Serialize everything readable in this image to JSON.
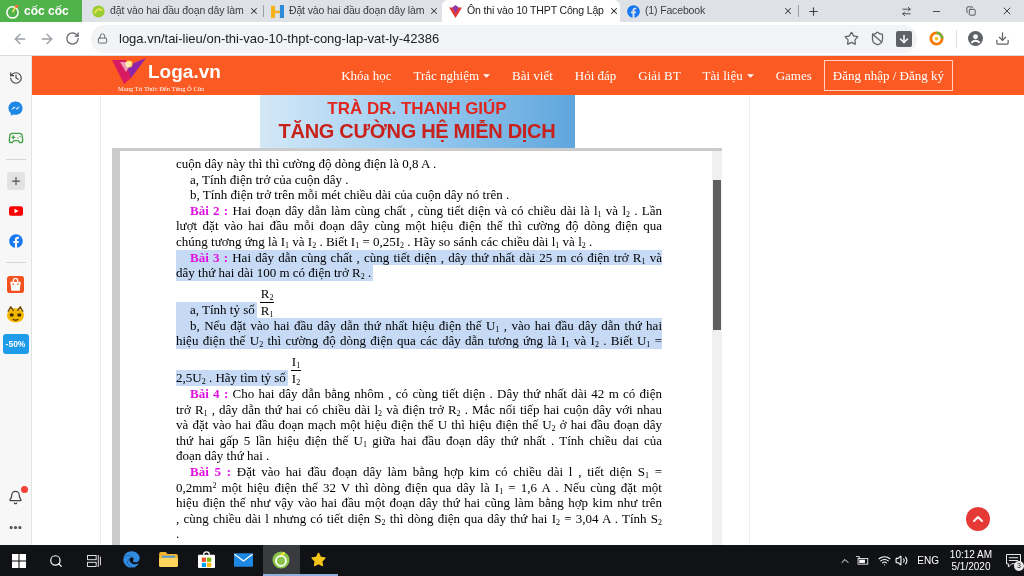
{
  "browser": {
    "brand": "cốc cốc",
    "tabs": [
      {
        "title": "đặt vào hai đầu đoạn dây làm",
        "kind": "swirl",
        "selected": false
      },
      {
        "title": "Đặt vào hai đầu đoạn dây làm",
        "kind": "bars",
        "selected": false
      },
      {
        "title": "Ôn thi vào 10 THPT Công Lập",
        "kind": "diamond",
        "selected": true
      },
      {
        "title": "(1) Facebook",
        "kind": "letter-f",
        "selected": false
      }
    ],
    "address": "loga.vn/tai-lieu/on-thi-vao-10-thpt-cong-lap-vat-ly-42386"
  },
  "sidebar": {
    "discount": "-50%",
    "notification_dot": true
  },
  "site": {
    "logo": "Loga.vn",
    "tagline": "Mang Tri Thức Đến Từng Ô Cửa",
    "nav": [
      {
        "label": "Khóa học",
        "dropdown": false
      },
      {
        "label": "Trắc nghiệm",
        "dropdown": true
      },
      {
        "label": "Bài viết",
        "dropdown": false
      },
      {
        "label": "Hỏi đáp",
        "dropdown": false
      },
      {
        "label": "Giải BT",
        "dropdown": false
      },
      {
        "label": "Tài liệu",
        "dropdown": true
      },
      {
        "label": "Games",
        "dropdown": false
      }
    ],
    "login": "Đăng nhập / Đăng ký"
  },
  "banner": {
    "lines": [
      "TRÀ DR. THANH GIÚP",
      "TĂNG CƯỜNG HỆ MIỄN DỊCH"
    ]
  },
  "document": {
    "lines": [
      {
        "kind": "line",
        "text": "cuộn dây này thì thì cường độ dòng điện là 0,8 A .",
        "indent": false,
        "full": false,
        "highlighted": false
      },
      {
        "kind": "line",
        "text": "a, Tính điện trở của cuộn dây .",
        "indent": true,
        "full": false,
        "highlighted": false
      },
      {
        "kind": "line",
        "text": "b, Tính điện trở trên mỗi mét chiều dài của cuộn dây nó trên .",
        "indent": true,
        "full": false,
        "highlighted": false
      },
      {
        "kind": "line",
        "text": "**Bài 2 :** Hai đoạn dây dẫn làm cùng chất , cùng tiết diện và có chiều dài là l$_{1}$ và l$_{2}$ . Lần",
        "indent": true,
        "full": true,
        "highlighted": false
      },
      {
        "kind": "line",
        "text": "lượt đặt vào hai đầu mỗi đoạn dây cùng một hiệu điện thế thì cường độ dòng điện qua",
        "indent": false,
        "full": true,
        "highlighted": false
      },
      {
        "kind": "line",
        "text": "chúng tương ứng là I$_{1}$ và I$_{2}$ . Biết I$_{1}$ = 0,25I$_{2}$ . Hãy so sánh các chiều dài l$_{1}$ và l$_{2}$ .",
        "indent": false,
        "full": false,
        "highlighted": false
      },
      {
        "kind": "line",
        "text": "**Bài 3 :** Hai dây dẫn cùng chất , cùng tiết diện , dây thứ nhất dài 25 m có điện trở R$_{1}$ và",
        "indent": true,
        "full": true,
        "highlighted": true
      },
      {
        "kind": "line",
        "text": "dây thứ hai dài 100 m có điện trở R$_{2}$ .",
        "indent": false,
        "full": false,
        "highlighted": true
      },
      {
        "kind": "fraction",
        "text": "a, Tính tỷ số",
        "numerator": "R$_{2}$",
        "denominator": "R$_{1}$",
        "indent": true,
        "highlighted": true
      },
      {
        "kind": "line",
        "text": "b, Nếu đặt vào hai đầu dây dẫn thứ nhất hiệu điện thế U$_{1}$ , vào hai đầu dây dẫn thứ hai",
        "indent": true,
        "full": true,
        "highlighted": true
      },
      {
        "kind": "line",
        "text": "hiệu điện thế U$_{2}$ thì cường độ dòng điện qua các dây dẫn tương ứng là I$_{1}$ và I$_{2}$ . Biết U$_{1}$ =",
        "indent": false,
        "full": true,
        "highlighted": true
      },
      {
        "kind": "fraction",
        "text": "2,5U$_{2}$ . Hãy tìm tỷ số",
        "numerator": "I$_{1}$",
        "denominator": "I$_{2}$",
        "indent": false,
        "highlighted": true
      },
      {
        "kind": "line",
        "text": "**Bài 4 :** Cho hai dây dẫn bằng nhôm , có cùng tiết diện . Dây thứ nhất dài 42 m có điện",
        "indent": true,
        "full": true,
        "highlighted": false
      },
      {
        "kind": "line",
        "text": "trở R$_{1}$ , dây dẫn thứ hai có chiều dài l$_{2}$ và điện trở R$_{2}$ . Mắc nối tiếp hai cuộn dây với nhau",
        "indent": false,
        "full": true,
        "highlighted": false
      },
      {
        "kind": "line",
        "text": "và đặt vào hai đầu đoạn mạch một hiệu điện thế U thì hiệu điện thế U$_{2}$ ở hai đầu đoạn dây",
        "indent": false,
        "full": true,
        "highlighted": false
      },
      {
        "kind": "line",
        "text": "thứ hai gấp 5 lần hiệu điện thế U$_{1}$ giữa hai đầu đoạn dây thứ nhất . Tính chiều dai của",
        "indent": false,
        "full": true,
        "highlighted": false
      },
      {
        "kind": "line",
        "text": "đoạn dây thứ hai .",
        "indent": false,
        "full": false,
        "highlighted": false
      },
      {
        "kind": "line",
        "text": "**Bài 5 :** Đặt vào hai đầu đoạn dây làm bằng hợp kim có chiều dài l , tiết diện S$_{1}$ =",
        "indent": true,
        "full": true,
        "highlighted": false
      },
      {
        "kind": "line",
        "text": "0,2mm$^{2}$ một hiệu điện thế 32 V thì dòng điện qua dây là I$_{1}$ = 1,6 A . Nếu cùng đặt một",
        "indent": false,
        "full": true,
        "highlighted": false
      },
      {
        "kind": "line",
        "text": "hiệu điện thế như vậy vào hai đầu một đoạn dây thứ hai cũng làm bằng hợp kim như trên",
        "indent": false,
        "full": true,
        "highlighted": false
      },
      {
        "kind": "line",
        "text": ", cùng chiều dài l nhưng có tiết diện S$_{2}$ thì dòng điện qua dây thứ hai I$_{2}$ = 3,04 A . Tính S$_{2}$",
        "indent": false,
        "full": true,
        "highlighted": false
      },
      {
        "kind": "line",
        "text": ".",
        "indent": false,
        "full": false,
        "highlighted": false
      }
    ]
  },
  "taskbar": {
    "apps": [
      {
        "kind": "edge",
        "running": false,
        "selected": false
      },
      {
        "kind": "folder",
        "running": false,
        "selected": false
      },
      {
        "kind": "store",
        "running": false,
        "selected": false
      },
      {
        "kind": "mail",
        "running": false,
        "selected": false
      },
      {
        "kind": "swirl",
        "running": true,
        "selected": true
      },
      {
        "kind": "star",
        "running": true,
        "selected": false
      }
    ],
    "language": "ENG",
    "time": "10:12 AM",
    "date": "5/1/2020",
    "notifications": "3"
  }
}
